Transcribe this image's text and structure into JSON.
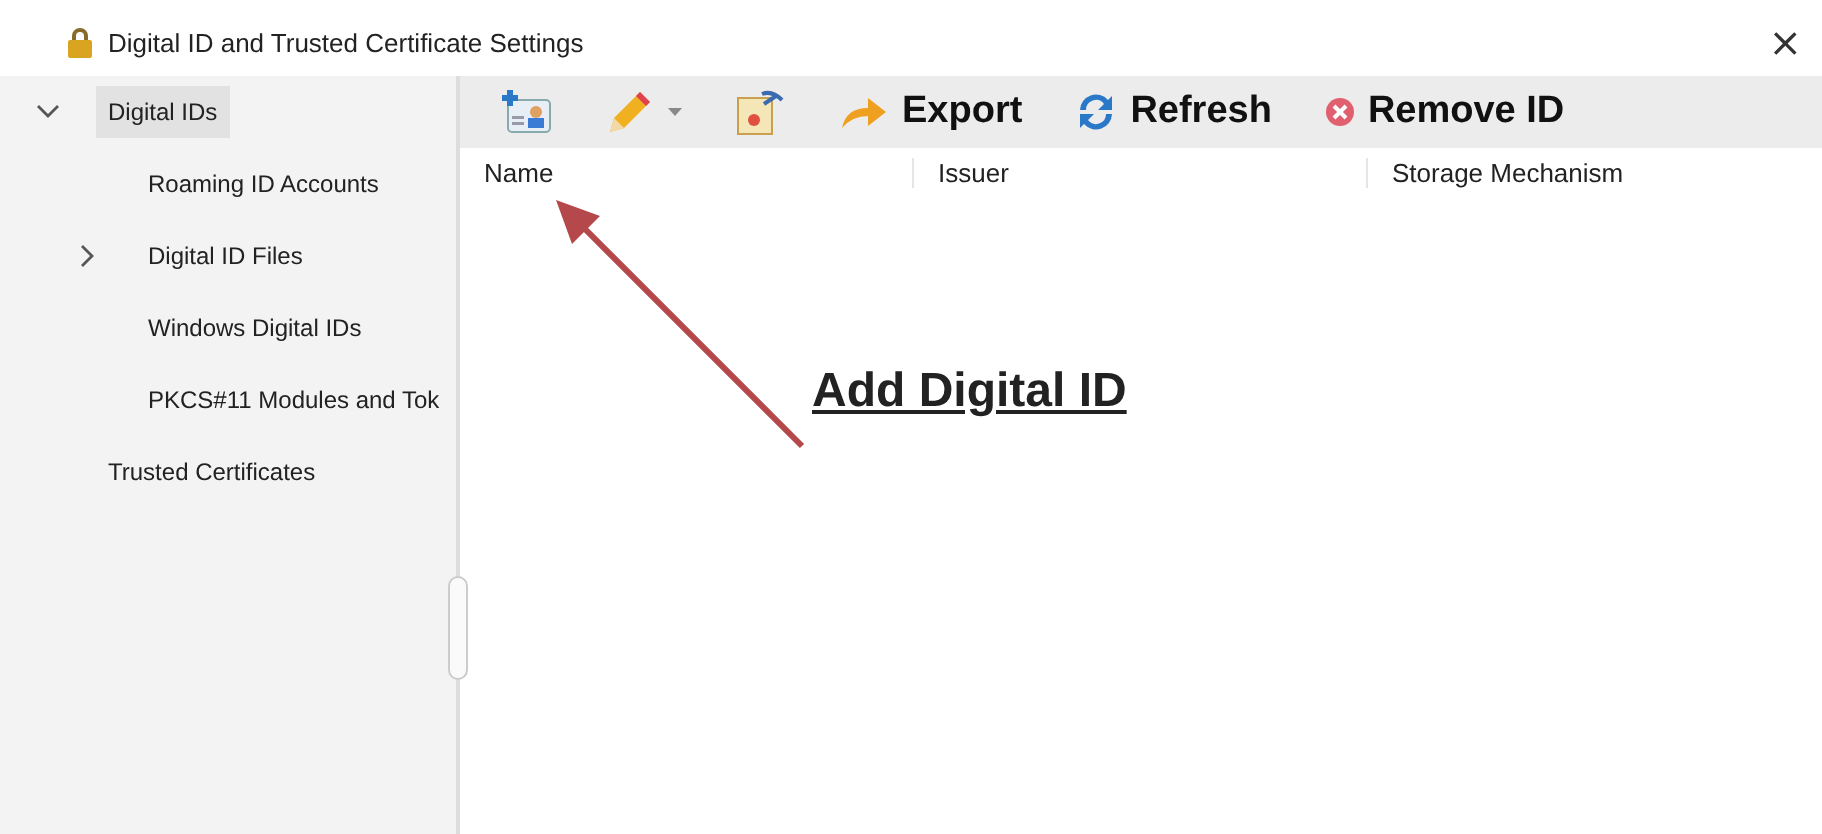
{
  "window": {
    "title": "Digital ID and Trusted Certificate Settings",
    "close": "×"
  },
  "sidebar": {
    "items": [
      {
        "label": "Digital IDs",
        "selected": true,
        "expanded": true,
        "children": [
          {
            "label": "Roaming ID Accounts",
            "selected": false
          },
          {
            "label": "Digital ID Files",
            "selected": false,
            "expanded": false
          },
          {
            "label": "Windows Digital IDs",
            "selected": false
          },
          {
            "label": "PKCS#11 Modules and Tok",
            "selected": false
          }
        ]
      },
      {
        "label": "Trusted Certificates",
        "selected": false
      }
    ]
  },
  "toolbar": [
    {
      "kind": "add"
    },
    {
      "kind": "edit",
      "dropdown": true
    },
    {
      "kind": "certificate"
    },
    {
      "kind": "export",
      "label": "Export"
    },
    {
      "kind": "refresh",
      "label": "Refresh"
    },
    {
      "kind": "remove",
      "label": "Remove ID"
    }
  ],
  "table": {
    "columns": [
      "Name",
      "Issuer",
      "Storage Mechanism"
    ]
  },
  "annotation": {
    "text": "Add Digital ID"
  }
}
